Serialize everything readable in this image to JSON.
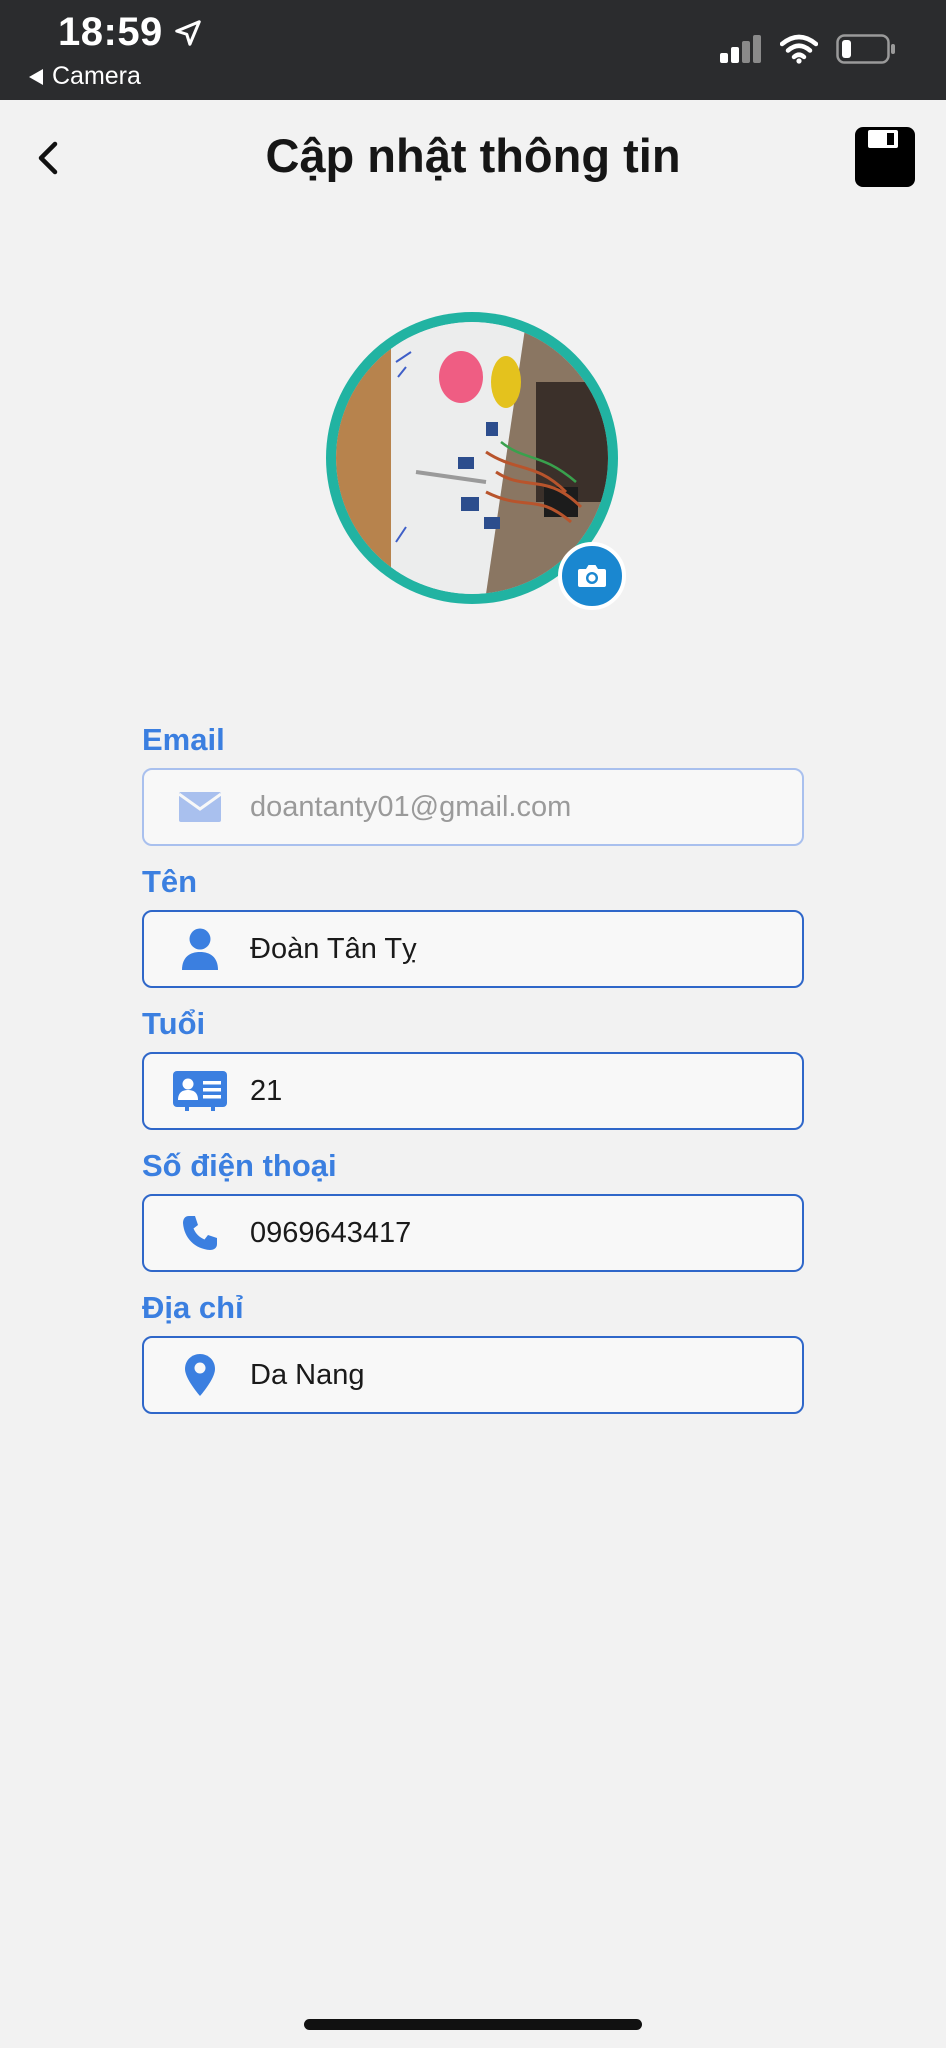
{
  "status_bar": {
    "time": "18:59",
    "back_app": "Camera"
  },
  "header": {
    "title": "Cập nhật thông tin"
  },
  "avatar": {
    "ring_color": "#21b3a2",
    "camera_button_color": "#1a87d0"
  },
  "form": {
    "fields": [
      {
        "label": "Email",
        "value": "doantanty01@gmail.com",
        "icon": "envelope-icon",
        "editable": false
      },
      {
        "label": "Tên",
        "value": "Đoàn Tân Tỵ",
        "icon": "user-icon",
        "editable": true
      },
      {
        "label": "Tuổi",
        "value": "21",
        "icon": "id-card-icon",
        "editable": true
      },
      {
        "label": "Số điện thoại",
        "value": "0969643417",
        "icon": "phone-icon",
        "editable": true
      },
      {
        "label": "Địa chỉ",
        "value": "Da Nang",
        "icon": "location-pin-icon",
        "editable": true
      }
    ]
  },
  "colors": {
    "label": "#3b7fe0",
    "field_border": "#2f67c9",
    "field_border_disabled": "#a9c0ee",
    "icon": "#3b7fe0"
  }
}
